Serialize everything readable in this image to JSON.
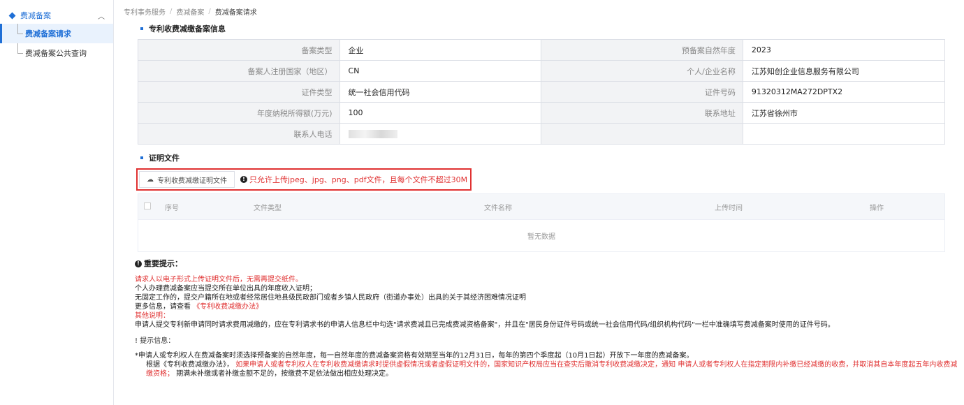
{
  "sidebar": {
    "group_label": "费减备案",
    "items": [
      {
        "label": "费减备案请求"
      },
      {
        "label": "费减备案公共查询"
      }
    ]
  },
  "breadcrumb": [
    "专利事务服务",
    "费减备案",
    "费减备案请求"
  ],
  "info_section": {
    "title": "专利收费减缴备案信息",
    "rows": [
      {
        "label1": "备案类型",
        "value1": "企业",
        "label2": "预备案自然年度",
        "value2": "2023"
      },
      {
        "label1": "备案人注册国家（地区）",
        "value1": "CN",
        "label2": "个人/企业名称",
        "value2": "江苏知创企业信息服务有限公司"
      },
      {
        "label1": "证件类型",
        "value1": "统一社会信用代码",
        "label2": "证件号码",
        "value2": "91320312MA272DPTX2"
      },
      {
        "label1": "年度纳税所得额(万元)",
        "value1": "100",
        "label2": "联系地址",
        "value2": "江苏省徐州市"
      },
      {
        "label1": "联系人电话",
        "value1": "",
        "label2": "",
        "value2": ""
      }
    ]
  },
  "proof_section": {
    "title": "证明文件",
    "upload_button": "专利收费减缴证明文件",
    "upload_hint": "只允许上传jpeg、jpg、png、pdf文件，且每个文件不超过30M",
    "columns": [
      "序号",
      "文件类型",
      "文件名称",
      "上传时间",
      "操作"
    ],
    "empty_text": "暂无数据"
  },
  "important": {
    "title": "重要提示：",
    "line1": "请求人以电子形式上传证明文件后，无需再提交纸件。",
    "line2": "个人办理费减备案应当提交所在单位出具的年度收入证明；",
    "line3": "无固定工作的，提交户籍所在地或者经常居住地县级民政部门或者乡镇人民政府（街道办事处）出具的关于其经济困难情况证明",
    "line4_prefix": "更多信息，请查看",
    "line4_link": "《专利收费减缴办法》",
    "line5": "其他说明：",
    "line6": "申请人提交专利新申请同时请求费用减缴的，应在专利请求书的申请人信息栏中勾选\"请求费减且已完成费减资格备案\"，并且在\"居民身份证件号码或统一社会信用代码/组织机构代码\"一栏中准确填写费减备案时使用的证件号码。"
  },
  "tips": {
    "title": "提示信息：",
    "line1": "*申请人或专利权人在费减备案时须选择预备案的自然年度，每一自然年度的费减备案资格有效期至当年的12月31日，每年的第四个季度起（10月1日起）开放下一年度的费减备案。",
    "line2_prefix": "根据《专利收费减缴办法》，",
    "line2_red": "如果申请人或者专利权人在专利收费减缴请求时提供虚假情况或者虚假证明文件的，国家知识产权局应当在查实后撤消专利收费减缴决定，通知 申请人或者专利权人在指定期限内补缴已经减缴的收费，并取消其自本年度起五年内收费减缴资格；",
    "line2_suffix": "期满未补缴或者补缴金额不足的，按缴费不足依法做出相应处理决定。"
  }
}
